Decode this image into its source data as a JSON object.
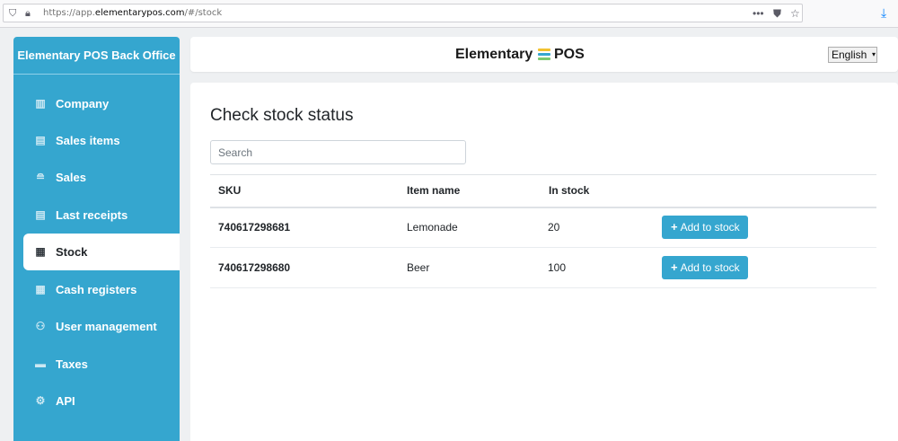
{
  "browser": {
    "url_prefix": "https://app.",
    "url_host": "elementarypos.com",
    "url_path": "/#/stock",
    "shield_icon": "shield-icon",
    "lock_icon": "lock-icon",
    "more_icon": "more-dots-icon",
    "pocket_icon": "pocket-icon",
    "star_icon": "bookmark-star-icon",
    "download_icon": "download-arrow-icon"
  },
  "sidebar": {
    "title": "Elementary POS Back Office",
    "items": [
      {
        "label": "Company",
        "icon": "building-icon"
      },
      {
        "label": "Sales items",
        "icon": "clipboard-icon"
      },
      {
        "label": "Sales",
        "icon": "coins-icon"
      },
      {
        "label": "Last receipts",
        "icon": "receipt-icon"
      },
      {
        "label": "Stock",
        "icon": "warehouse-icon",
        "active": true
      },
      {
        "label": "Cash registers",
        "icon": "calculator-icon"
      },
      {
        "label": "User management",
        "icon": "users-icon"
      },
      {
        "label": "Taxes",
        "icon": "briefcase-icon"
      },
      {
        "label": "API",
        "icon": "gear-icon"
      }
    ]
  },
  "header": {
    "logo_left": "Elementary",
    "logo_right": "POS",
    "logo_colors": [
      "#f2c230",
      "#35a6cf",
      "#7bc96f"
    ],
    "language": "English"
  },
  "main": {
    "title": "Check stock status",
    "search_placeholder": "Search",
    "columns": {
      "sku": "SKU",
      "name": "Item name",
      "stock": "In stock"
    },
    "rows": [
      {
        "sku": "740617298681",
        "name": "Lemonade",
        "stock": "20",
        "action": "Add to stock"
      },
      {
        "sku": "740617298680",
        "name": "Beer",
        "stock": "100",
        "action": "Add to stock"
      }
    ]
  },
  "colors": {
    "accent": "#35a6cf",
    "page_bg": "#eef0f2"
  }
}
